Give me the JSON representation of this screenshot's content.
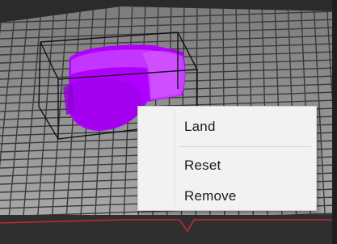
{
  "viewport": {
    "background_color": "#2e2e2e",
    "bed_color": "#9a9a9a",
    "grid_line_color": "#2a2a2a",
    "model_color": "#b400ff",
    "model_highlight_color": "#d04cff",
    "bounding_box_color": "#111111",
    "accent_line_color": "#c0283a"
  },
  "context_menu": {
    "items": [
      {
        "label": "Land"
      },
      {
        "label": "Reset"
      },
      {
        "label": "Remove"
      }
    ]
  }
}
